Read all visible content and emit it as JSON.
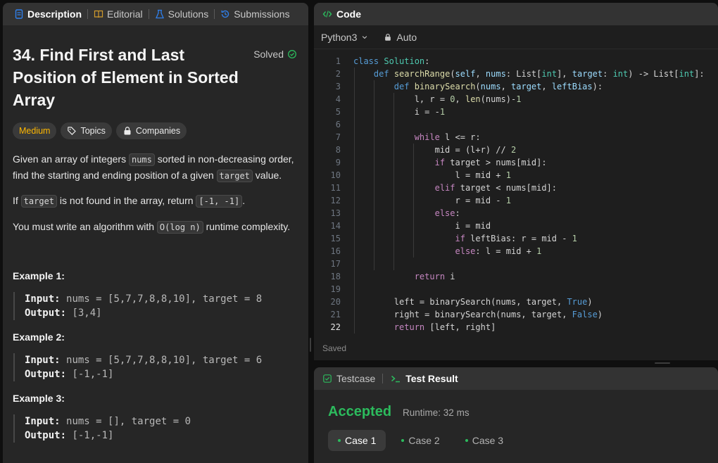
{
  "left_tabs": {
    "description": "Description",
    "editorial": "Editorial",
    "solutions": "Solutions",
    "submissions": "Submissions"
  },
  "problem": {
    "title": "34. Find First and Last Position of Element in Sorted Array",
    "status": "Solved",
    "difficulty": "Medium",
    "topics": "Topics",
    "companies": "Companies",
    "p1": {
      "a": "Given an array of integers ",
      "code1": "nums",
      "b": " sorted in non-decreasing order, find the starting and ending position of a given ",
      "code2": "target",
      "c": " value."
    },
    "p2": {
      "a": "If ",
      "code1": "target",
      "b": " is not found in the array, return ",
      "code2": "[-1, -1]",
      "c": "."
    },
    "p3": {
      "a": "You must write an algorithm with ",
      "code1": "O(log n)",
      "b": " runtime complexity."
    },
    "examples": [
      {
        "heading": "Example 1:",
        "input_label": "Input:",
        "input": "nums = [5,7,7,8,8,10], target = 8",
        "output_label": "Output:",
        "output": "[3,4]"
      },
      {
        "heading": "Example 2:",
        "input_label": "Input:",
        "input": "nums = [5,7,7,8,8,10], target = 6",
        "output_label": "Output:",
        "output": "[-1,-1]"
      },
      {
        "heading": "Example 3:",
        "input_label": "Input:",
        "input": "nums = [], target = 0",
        "output_label": "Output:",
        "output": "[-1,-1]"
      }
    ]
  },
  "code_panel": {
    "title": "Code",
    "language": "Python3",
    "mode": "Auto",
    "status": "Saved",
    "line_numbers": [
      "1",
      "2",
      "3",
      "4",
      "5",
      "6",
      "7",
      "8",
      "9",
      "10",
      "11",
      "12",
      "13",
      "14",
      "15",
      "16",
      "17",
      "18",
      "19",
      "20",
      "21",
      "22"
    ]
  },
  "result_panel": {
    "tab_testcase": "Testcase",
    "tab_result": "Test Result",
    "verdict": "Accepted",
    "runtime": "Runtime: 32 ms",
    "cases": [
      "Case 1",
      "Case 2",
      "Case 3"
    ]
  },
  "colors": {
    "accepted": "#2cbb5d",
    "medium": "#ffb800",
    "link_blue": "#2f80ed"
  }
}
